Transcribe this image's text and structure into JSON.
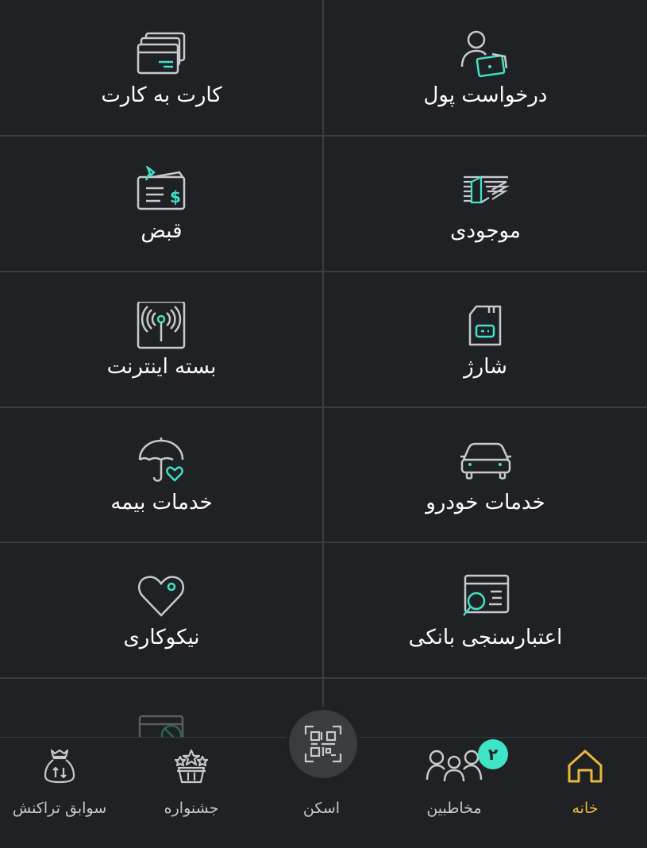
{
  "services": [
    {
      "label": "درخواست پول",
      "icon": "money-request-icon"
    },
    {
      "label": "کارت به کارت",
      "icon": "card-to-card-icon"
    },
    {
      "label": "موجودی",
      "icon": "balance-icon"
    },
    {
      "label": "قبض",
      "icon": "bill-icon"
    },
    {
      "label": "شارژ",
      "icon": "sim-card-icon"
    },
    {
      "label": "بسته اینترنت",
      "icon": "internet-package-icon"
    },
    {
      "label": "خدمات خودرو",
      "icon": "car-icon"
    },
    {
      "label": "خدمات بیمه",
      "icon": "insurance-umbrella-icon"
    },
    {
      "label": "اعتبارسنجی بانکی",
      "icon": "credit-check-icon"
    },
    {
      "label": "نیکوکاری",
      "icon": "charity-heart-icon"
    }
  ],
  "bottom_nav": {
    "home": "خانه",
    "contacts": "مخاطبین",
    "contacts_badge": "۲",
    "scan": "اسکن",
    "festival": "جشنواره",
    "history": "سوابق تراکنش"
  },
  "colors": {
    "accent": "#3fe3c6",
    "active": "#e8b83c",
    "background": "#1f2124",
    "icon_gray": "#c8c9cb"
  }
}
